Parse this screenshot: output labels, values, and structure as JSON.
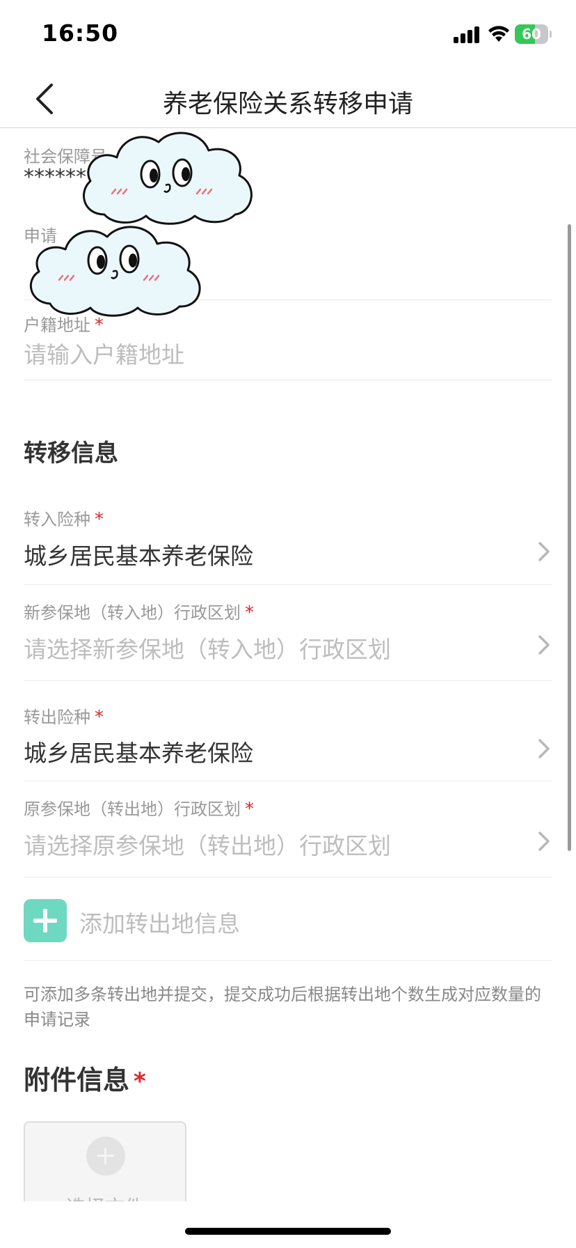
{
  "status_bar": {
    "time": "16:50",
    "battery_level": "60"
  },
  "nav": {
    "title": "养老保险关系转移申请",
    "back_icon": "chevron-left-icon"
  },
  "personal_info": {
    "ssn_label": "社会保障号",
    "ssn_value": "******",
    "applicant_label": "申请",
    "household_address": {
      "label": "户籍地址",
      "placeholder": "请输入户籍地址"
    }
  },
  "transfer_section": {
    "title": "转移信息",
    "transfer_in_type": {
      "label": "转入险种",
      "value": "城乡居民基本养老保险"
    },
    "new_region": {
      "label": "新参保地（转入地）行政区划",
      "placeholder": "请选择新参保地（转入地）行政区划"
    },
    "transfer_out_type": {
      "label": "转出险种",
      "value": "城乡居民基本养老保险"
    },
    "original_region": {
      "label": "原参保地（转出地）行政区划",
      "placeholder": "请选择原参保地（转出地）行政区划"
    },
    "add_button": "添加转出地信息",
    "hint": "可添加多条转出地并提交，提交成功后根据转出地个数生成对应数量的申请记录"
  },
  "attachment_section": {
    "title": "附件信息",
    "upload_label": "选择文件"
  },
  "required_mark": "*",
  "colors": {
    "accent": "#6fd8c0",
    "required": "#e0252e",
    "battery": "#34c759"
  }
}
